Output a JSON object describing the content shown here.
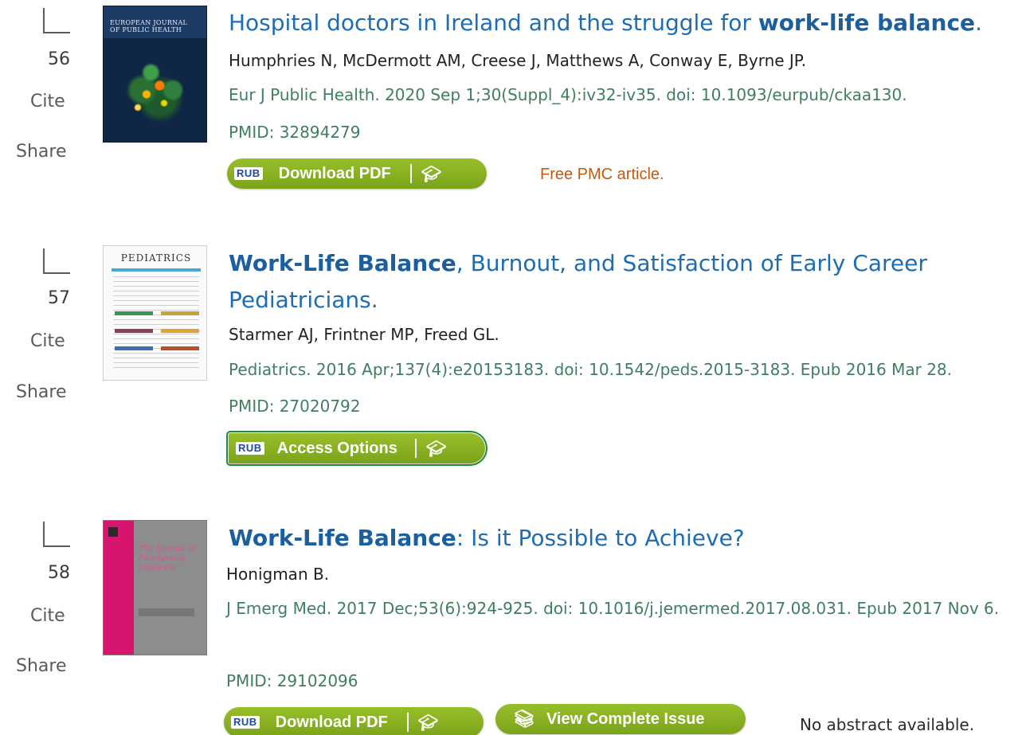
{
  "results": [
    {
      "number": "56",
      "cite_label": "Cite",
      "share_label": "Share",
      "cover_text": "EUROPEAN JOURNAL OF PUBLIC HEALTH",
      "title_plain": "Hospital doctors in Ireland and the struggle for ",
      "title_bold": "work-life balance",
      "title_end": ".",
      "authors": "Humphries N, McDermott AM, Creese J, Matthews A, Conway E, Byrne JP.",
      "citation": "Eur J Public Health. 2020 Sep 1;30(Suppl_4):iv32-iv35. doi: 10.1093/eurpub/ckaa130.",
      "pmid": "PMID: 32894279",
      "button_label": "Download PDF",
      "rub": "RUB",
      "note": "Free PMC article."
    },
    {
      "number": "57",
      "cite_label": "Cite",
      "share_label": "Share",
      "cover_text": "PEDIATRICS",
      "title_bold": "Work-Life Balance",
      "title_plain": ", Burnout, and Satisfaction of Early Career Pediatricians.",
      "authors": "Starmer AJ, Frintner MP, Freed GL.",
      "citation": "Pediatrics. 2016 Apr;137(4):e20153183. doi: 10.1542/peds.2015-3183. Epub 2016 Mar 28.",
      "pmid": "PMID: 27020792",
      "button_label": "Access Options",
      "rub": "RUB"
    },
    {
      "number": "58",
      "cite_label": "Cite",
      "share_label": "Share",
      "cover_text": "The Journal of Emergency Medicine",
      "title_bold": "Work-Life Balance",
      "title_plain": ": Is it Possible to Achieve?",
      "authors": "Honigman B.",
      "citation": "J Emerg Med. 2017 Dec;53(6):924-925. doi: 10.1016/j.jemermed.2017.08.031. Epub 2017 Nov 6.",
      "pmid": "PMID: 29102096",
      "button_label": "Download PDF",
      "rub": "RUB",
      "issue_label": "View Complete Issue",
      "note": "No abstract available."
    }
  ],
  "icons": {
    "checkbox": "checkbox-icon",
    "cap": "graduation-cap-icon",
    "book": "book-icon"
  },
  "colors": {
    "title_link": "#1e6db3",
    "citation_green": "#3f7f5f",
    "button_green": "#8cb521",
    "free_orange": "#c25a12"
  }
}
